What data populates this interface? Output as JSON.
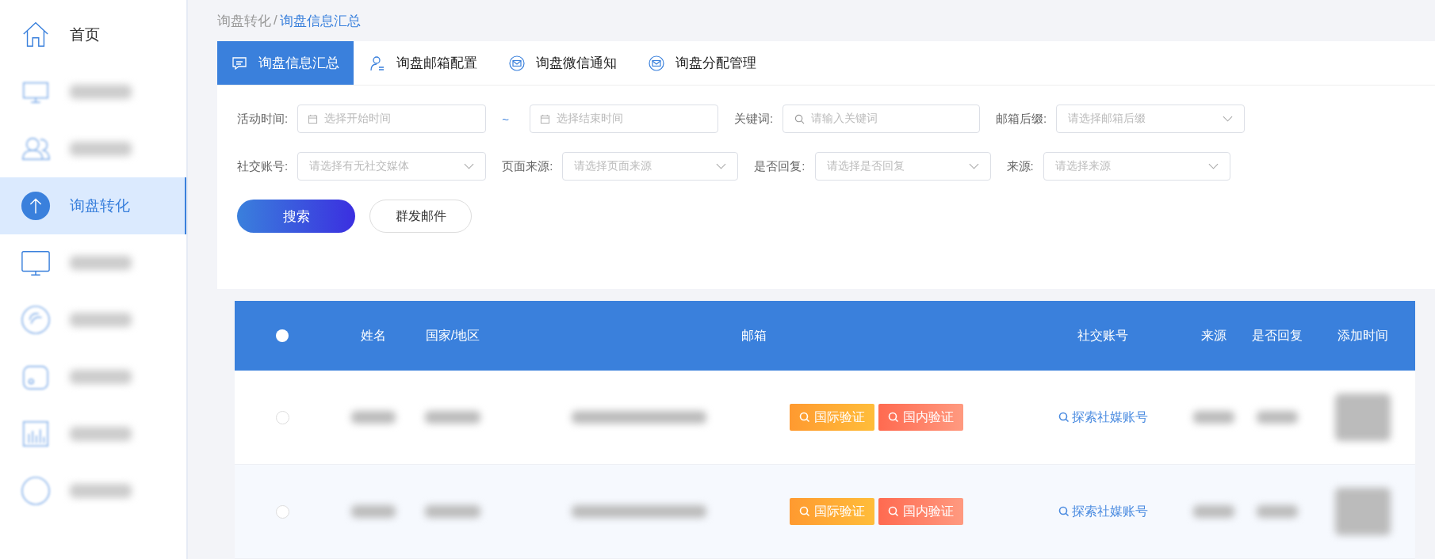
{
  "sidebar": {
    "items": [
      {
        "label": "首页",
        "selected": false
      },
      {
        "selected": false
      },
      {
        "selected": false
      },
      {
        "label": "询盘转化",
        "selected": true
      },
      {
        "selected": false
      },
      {
        "selected": false
      },
      {
        "selected": false
      },
      {
        "selected": false
      },
      {
        "selected": false
      }
    ]
  },
  "breadcrumb": [
    "询盘转化",
    "/",
    "询盘信息汇总"
  ],
  "tabs": [
    {
      "label": "询盘信息汇总",
      "selected": true
    },
    {
      "label": "询盘邮箱配置",
      "selected": false
    },
    {
      "label": "询盘微信通知",
      "selected": false
    },
    {
      "label": "询盘分配管理",
      "selected": false
    }
  ],
  "filters": {
    "rows": [
      {
        "fields": [
          {
            "kind": "date",
            "label": "活动时间:",
            "placeholder": "选择开始时间"
          },
          {
            "kind": "separator",
            "label": "~"
          },
          {
            "kind": "date",
            "placeholder": "选择结束时间"
          },
          {
            "kind": "search",
            "label": "关键词:",
            "placeholder": "请输入关键词"
          },
          {
            "kind": "select",
            "label": "邮箱后缀:",
            "placeholder": "请选择邮箱后缀"
          }
        ]
      },
      {
        "fields": [
          {
            "kind": "select",
            "label": "社交账号:",
            "placeholder": "请选择有无社交媒体"
          },
          {
            "kind": "select",
            "label": "页面来源:",
            "placeholder": "请选择页面来源"
          },
          {
            "kind": "select",
            "label": "是否回复:",
            "placeholder": "请选择是否回复"
          },
          {
            "kind": "select",
            "label": "来源:",
            "placeholder": "请选择来源"
          }
        ]
      }
    ],
    "buttons": [
      {
        "kind": "primary",
        "label": "搜索"
      },
      {
        "kind": "plain",
        "label": "群发邮件"
      }
    ]
  },
  "table": {
    "select_all": {
      "checked": false
    },
    "columns": [
      "姓名",
      "国家/地区",
      "邮箱",
      "社交账号",
      "来源",
      "是否回复",
      "添加时间"
    ],
    "rows": [
      {
        "selected": false,
        "verify_buttons": [
          "国际验证",
          "国内验证"
        ],
        "social_link": "探索社媒账号"
      },
      {
        "selected": false,
        "verify_buttons": [
          "国际验证",
          "国内验证"
        ],
        "social_link": "探索社媒账号"
      }
    ]
  }
}
